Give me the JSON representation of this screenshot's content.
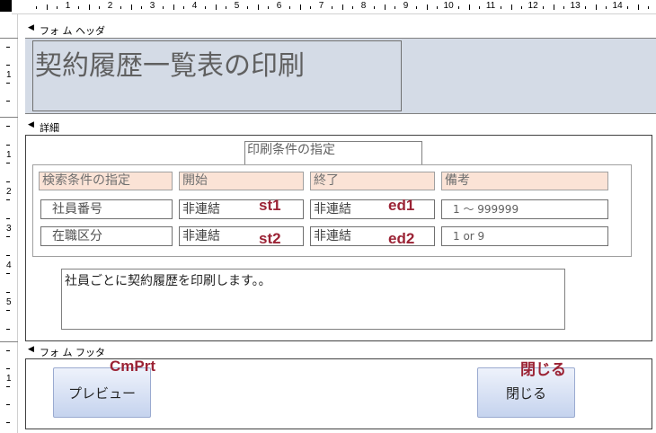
{
  "ruler": {
    "h_numbers": [
      "1",
      "2",
      "3",
      "4",
      "5",
      "6",
      "7",
      "8",
      "9",
      "10",
      "11",
      "12",
      "13",
      "14"
    ],
    "v_header_numbers": [
      "1"
    ],
    "v_detail_numbers": [
      "1",
      "2",
      "3",
      "4",
      "5"
    ],
    "v_footer_numbers": [
      "1"
    ]
  },
  "sections": {
    "header_label": "フォ ム ヘッダ",
    "detail_label": "詳細",
    "footer_label": "フォ ム フッタ"
  },
  "header": {
    "title": "契約履歴一覧表の印刷"
  },
  "detail": {
    "group_title": "印刷条件の指定",
    "columns": [
      "検索条件の指定",
      "開始",
      "終了",
      "備考"
    ],
    "rows": [
      {
        "label": "社員番号",
        "start": "非連結",
        "start_name": "st1",
        "end": "非連結",
        "end_name": "ed1",
        "note": "1 〜 999999"
      },
      {
        "label": "在職区分",
        "start": "非連結",
        "start_name": "st2",
        "end": "非連結",
        "end_name": "ed2",
        "note": "1 or 9"
      }
    ],
    "description": "社員ごとに契約履歴を印刷します。。"
  },
  "footer": {
    "preview_button": "プレビュー",
    "preview_name": "CmPrt",
    "close_button": "閉じる",
    "close_name": "閉じる"
  }
}
